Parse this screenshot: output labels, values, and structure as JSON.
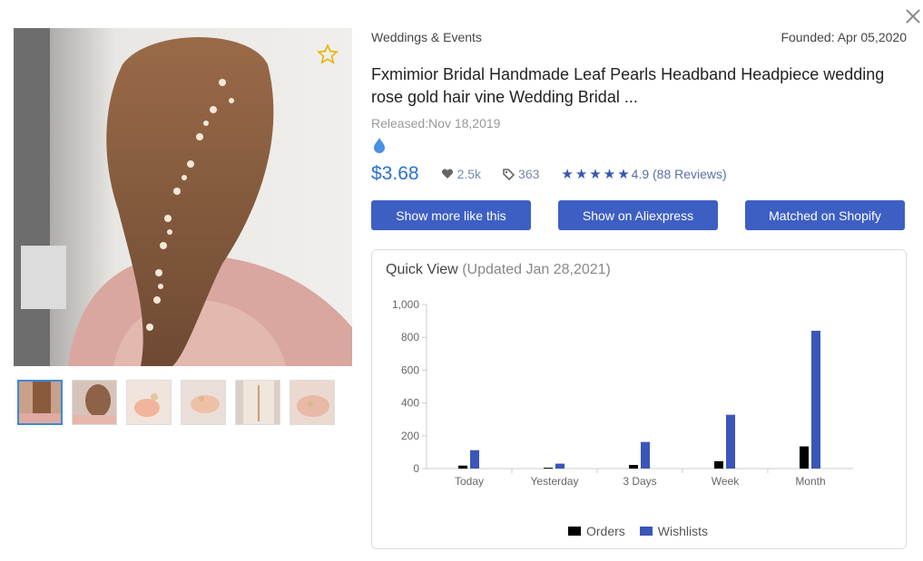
{
  "header": {
    "category": "Weddings & Events",
    "founded": "Founded: Apr 05,2020"
  },
  "product": {
    "title": "Fxmimior Bridal Handmade Leaf Pearls Headband Headpiece wedding rose gold hair vine Wedding Bridal ...",
    "released": "Released:Nov 18,2019",
    "price": "$3.68",
    "likes": "2.5k",
    "tags": "363",
    "rating_text": "4.9 (88 Reviews)",
    "rating_value": 4.9,
    "star_count": 5
  },
  "buttons": {
    "more_like_this": "Show more like this",
    "aliexpress": "Show on Aliexpress",
    "shopify": "Matched on Shopify"
  },
  "quick_view": {
    "title": "Quick View",
    "updated": "(Updated Jan 28,2021)"
  },
  "colors": {
    "accent": "#3d5fc4",
    "price": "#2a6fd6",
    "orders": "#000000",
    "wishlists": "#3a56b8"
  },
  "icons": [
    "close-icon",
    "star-outline-icon",
    "fire-drop-icon",
    "heart-icon",
    "tag-icon",
    "star-icon"
  ],
  "chart_data": {
    "type": "bar",
    "categories": [
      "Today",
      "Yesterday",
      "3 Days",
      "Week",
      "Month"
    ],
    "series": [
      {
        "name": "Orders",
        "values": [
          18,
          5,
          22,
          45,
          135
        ]
      },
      {
        "name": "Wishlists",
        "values": [
          112,
          30,
          162,
          328,
          840
        ]
      }
    ],
    "ylim": [
      0,
      1000
    ],
    "yticks": [
      "0",
      "200",
      "400",
      "600",
      "800",
      "1,000"
    ],
    "legend": "bottom",
    "grid": false
  }
}
